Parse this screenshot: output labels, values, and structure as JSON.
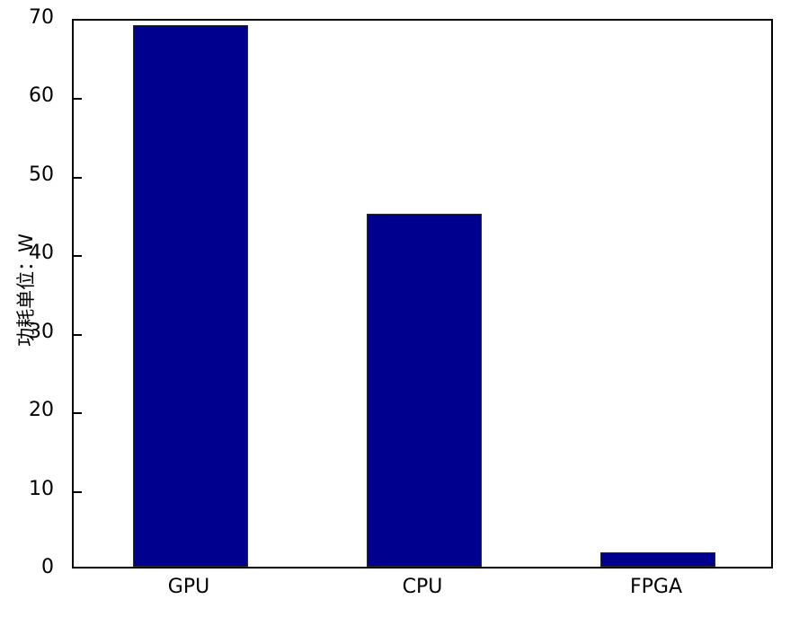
{
  "figure": {
    "background_color": "#ffffff",
    "axes_color": "#000000",
    "bar_color": "#00008f",
    "bar_edge_color": "#2b2b2b"
  },
  "chart_data": {
    "type": "bar",
    "title": "",
    "xlabel": "",
    "ylabel": "功耗单位：W",
    "categories": [
      "GPU",
      "CPU",
      "FPGA"
    ],
    "values": [
      69,
      45,
      1.8
    ],
    "series": [
      {
        "name": "功耗",
        "values": [
          69,
          45,
          1.8
        ]
      }
    ],
    "ylim": [
      0,
      70
    ],
    "yticks": [
      0,
      10,
      20,
      30,
      40,
      50,
      60,
      70
    ],
    "ytick_labels": [
      "0",
      "10",
      "20",
      "30",
      "40",
      "50",
      "60",
      "70"
    ],
    "xtick_labels": [
      "GPU",
      "CPU",
      "FPGA"
    ],
    "grid": false,
    "legend": null,
    "bar_color": "#00008f",
    "annotations": []
  }
}
